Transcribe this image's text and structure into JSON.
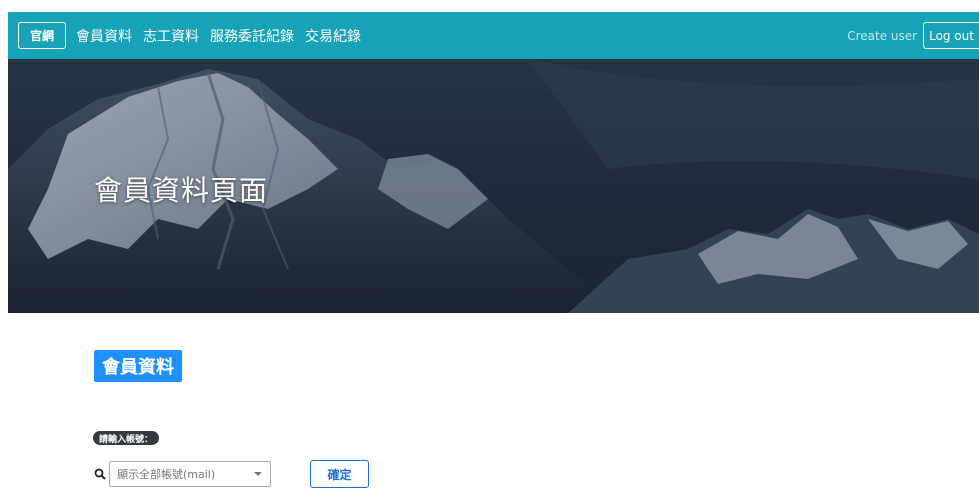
{
  "navbar": {
    "brand_label": "官網",
    "links": [
      "會員資料",
      "志工資料",
      "服務委託紀錄",
      "交易紀錄"
    ],
    "create_user_label": "Create user",
    "logout_label": "Log out",
    "background_color": "#17a2b8"
  },
  "hero": {
    "title": "會員資料頁面"
  },
  "main": {
    "section_title": "會員資料",
    "prompt_label": "請輸入帳號：",
    "account_select": {
      "selected_value": "顯示全部帳號(mail)"
    },
    "confirm_label": "確定",
    "search_icon": "search-icon"
  }
}
